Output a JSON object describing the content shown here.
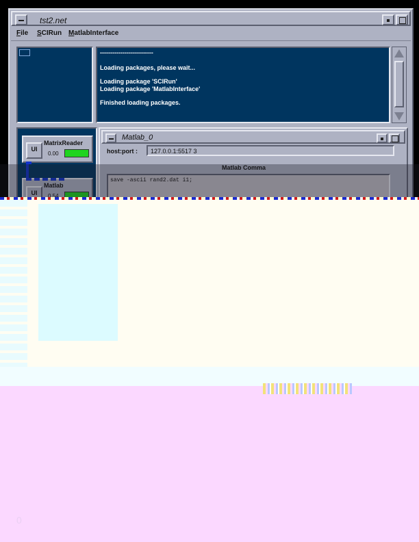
{
  "window": {
    "title": "tst2.net"
  },
  "menubar": {
    "items": [
      "File",
      "SCIRun",
      "MatlabInterface"
    ]
  },
  "log": {
    "lines": [
      "--------------------------",
      "",
      "Loading packages, please wait...",
      "",
      "Loading package 'SCIRun'",
      "Loading package 'MatlabInterface'",
      "",
      "Finished loading packages."
    ]
  },
  "modules": [
    {
      "ui_label": "UI",
      "title": "MatrixReader",
      "time": "0.00",
      "progress": 1.0
    },
    {
      "ui_label": "UI",
      "title": "Matlab",
      "time": "0.54",
      "progress": 1.0
    }
  ],
  "matlab_window": {
    "title": "Matlab_0",
    "host_label": "host:port :",
    "host_value": "127.0.0.1:5517 3",
    "command_label": "Matlab Comma",
    "command_text": "save -ascii rand2.dat i1;"
  },
  "colors": {
    "panel_blue": "#00355f",
    "motif_gray": "#aeb2c3",
    "progress_green": "#1fd41f"
  },
  "bottom_mark": "0"
}
